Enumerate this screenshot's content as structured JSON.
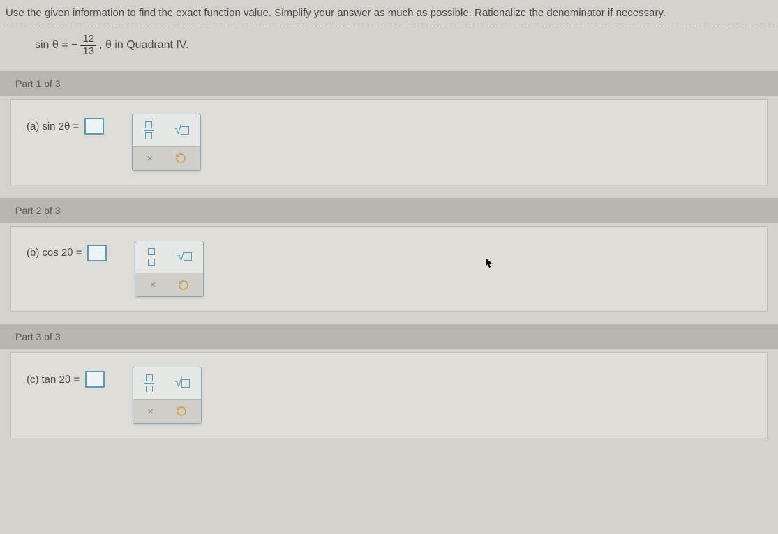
{
  "instructions": "Use the given information to find the exact function value. Simplify your answer as much as possible. Rationalize the denominator if necessary.",
  "given": {
    "prefix": "sin θ = −",
    "numerator": "12",
    "denominator": "13",
    "suffix": ", θ in Quadrant IV."
  },
  "parts": [
    {
      "header": "Part 1 of 3",
      "label_prefix": "(a)",
      "func": "sin 2θ ="
    },
    {
      "header": "Part 2 of 3",
      "label_prefix": "(b)",
      "func": "cos 2θ ="
    },
    {
      "header": "Part 3 of 3",
      "label_prefix": "(c)",
      "func": "tan 2θ ="
    }
  ],
  "tools": {
    "fraction": "fraction",
    "sqrt": "√",
    "close": "×",
    "reset": "↺"
  }
}
